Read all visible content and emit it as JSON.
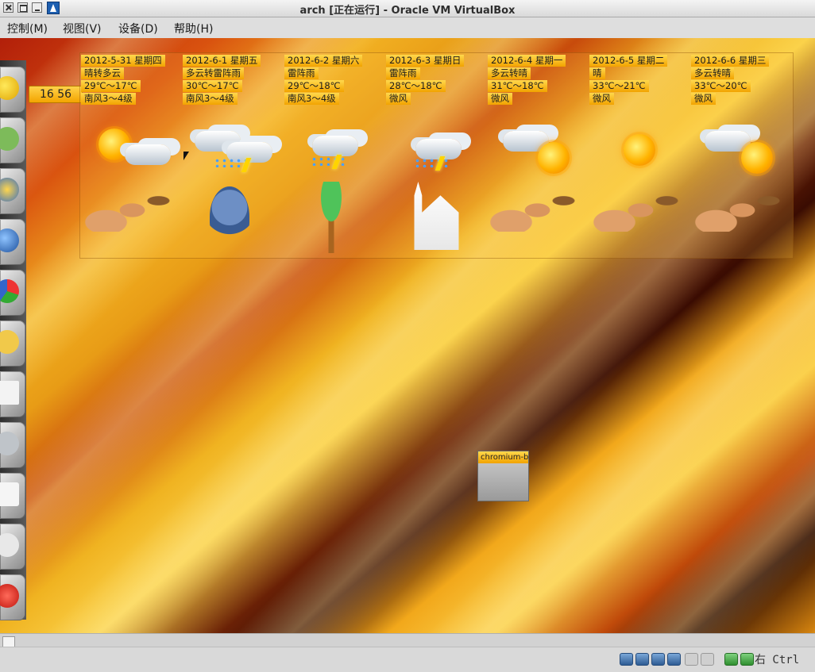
{
  "window": {
    "title": "arch [正在运行] - Oracle VM VirtualBox"
  },
  "menu": [
    "控制(M)",
    "视图(V)",
    "设备(D)",
    "帮助(H)"
  ],
  "clock": "16 56",
  "forecast": [
    {
      "date": "2012-5-31 星期四",
      "condition": "晴转多云",
      "temp": "29℃～17℃",
      "wind": "南风3～4级",
      "icon": "sun-cloud-icon",
      "figure": "beach-lady"
    },
    {
      "date": "2012-6-1 星期五",
      "condition": "多云转雷阵雨",
      "temp": "30℃～17℃",
      "wind": "南风3～4级",
      "icon": "thunderstorm-icon",
      "figure": "critter"
    },
    {
      "date": "2012-6-2 星期六",
      "condition": "雷阵雨",
      "temp": "29℃～18℃",
      "wind": "南风3～4级",
      "icon": "thunderstorm-icon",
      "figure": "palm-tree"
    },
    {
      "date": "2012-6-3 星期日",
      "condition": "雷阵雨",
      "temp": "28℃～18℃",
      "wind": "微风",
      "icon": "thunderstorm-icon",
      "figure": "church"
    },
    {
      "date": "2012-6-4 星期一",
      "condition": "多云转晴",
      "temp": "31℃～18℃",
      "wind": "微风",
      "icon": "cloud-sun-icon",
      "figure": "beach-lady"
    },
    {
      "date": "2012-6-5 星期二",
      "condition": "晴",
      "temp": "33℃～21℃",
      "wind": "微风",
      "icon": "sun-icon",
      "figure": "beach-lady"
    },
    {
      "date": "2012-6-6 星期三",
      "condition": "多云转晴",
      "temp": "33℃～20℃",
      "wind": "微风",
      "icon": "cloud-sun-icon",
      "figure": "beach-lady"
    }
  ],
  "desktop_icon": {
    "label": "chromium-br"
  },
  "statusbar": {
    "host_key": "右 Ctrl"
  }
}
